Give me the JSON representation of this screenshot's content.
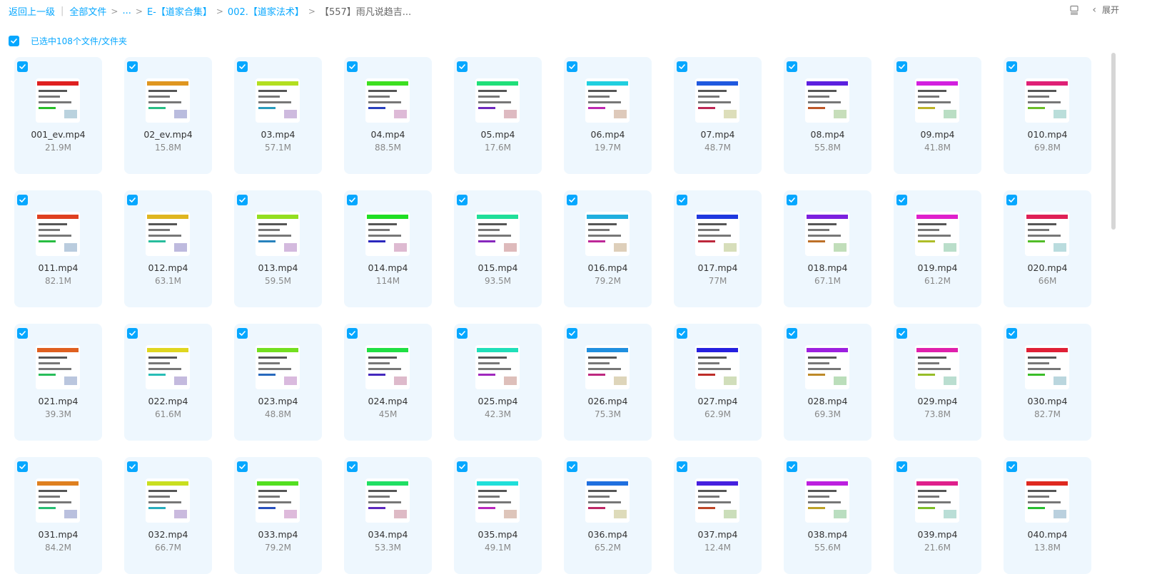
{
  "breadcrumb": {
    "back": "返回上一级",
    "all_files": "全部文件",
    "ellipsis": "...",
    "level1": "E-【道家合集】",
    "level2": "002.【道家法术】",
    "current": "【557】雨凡说趋吉..."
  },
  "toolbar": {
    "expand_label": "展开"
  },
  "selection": {
    "text": "已选中108个文件/文件夹"
  },
  "colors": {
    "accent": "#06a7ff",
    "card_bg": "#eef7fe"
  },
  "files": [
    {
      "name": "001_ev.mp4",
      "size": "21.9M"
    },
    {
      "name": "02_ev.mp4",
      "size": "15.8M"
    },
    {
      "name": "03.mp4",
      "size": "57.1M"
    },
    {
      "name": "04.mp4",
      "size": "88.5M"
    },
    {
      "name": "05.mp4",
      "size": "17.6M"
    },
    {
      "name": "06.mp4",
      "size": "19.7M"
    },
    {
      "name": "07.mp4",
      "size": "48.7M"
    },
    {
      "name": "08.mp4",
      "size": "55.8M"
    },
    {
      "name": "09.mp4",
      "size": "41.8M"
    },
    {
      "name": "010.mp4",
      "size": "69.8M"
    },
    {
      "name": "011.mp4",
      "size": "82.1M"
    },
    {
      "name": "012.mp4",
      "size": "63.1M"
    },
    {
      "name": "013.mp4",
      "size": "59.5M"
    },
    {
      "name": "014.mp4",
      "size": "114M"
    },
    {
      "name": "015.mp4",
      "size": "93.5M"
    },
    {
      "name": "016.mp4",
      "size": "79.2M"
    },
    {
      "name": "017.mp4",
      "size": "77M"
    },
    {
      "name": "018.mp4",
      "size": "67.1M"
    },
    {
      "name": "019.mp4",
      "size": "61.2M"
    },
    {
      "name": "020.mp4",
      "size": "66M"
    },
    {
      "name": "021.mp4",
      "size": "39.3M"
    },
    {
      "name": "022.mp4",
      "size": "61.6M"
    },
    {
      "name": "023.mp4",
      "size": "48.8M"
    },
    {
      "name": "024.mp4",
      "size": "45M"
    },
    {
      "name": "025.mp4",
      "size": "42.3M"
    },
    {
      "name": "026.mp4",
      "size": "75.3M"
    },
    {
      "name": "027.mp4",
      "size": "62.9M"
    },
    {
      "name": "028.mp4",
      "size": "69.3M"
    },
    {
      "name": "029.mp4",
      "size": "73.8M"
    },
    {
      "name": "030.mp4",
      "size": "82.7M"
    },
    {
      "name": "031.mp4",
      "size": "84.2M"
    },
    {
      "name": "032.mp4",
      "size": "66.7M"
    },
    {
      "name": "033.mp4",
      "size": "79.2M"
    },
    {
      "name": "034.mp4",
      "size": "53.3M"
    },
    {
      "name": "035.mp4",
      "size": "49.1M"
    },
    {
      "name": "036.mp4",
      "size": "65.2M"
    },
    {
      "name": "037.mp4",
      "size": "12.4M"
    },
    {
      "name": "038.mp4",
      "size": "55.6M"
    },
    {
      "name": "039.mp4",
      "size": "21.6M"
    },
    {
      "name": "040.mp4",
      "size": "13.8M"
    }
  ]
}
